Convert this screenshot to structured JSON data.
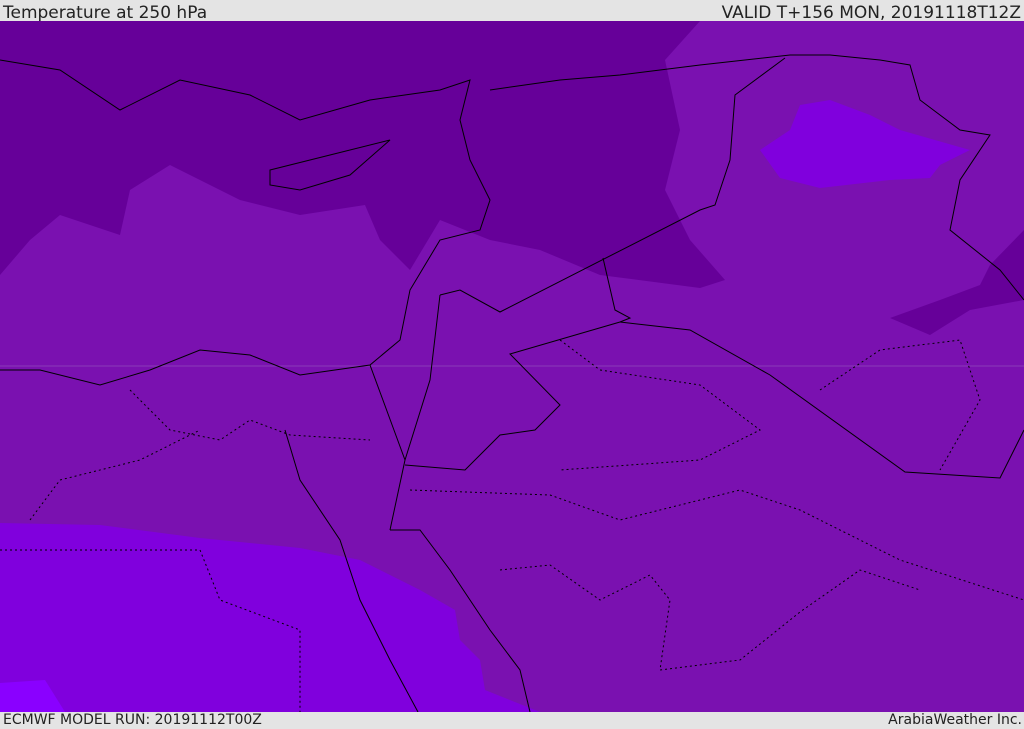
{
  "header": {
    "title": "Temperature at 250 hPa",
    "valid": "VALID T+156 MON, 20191118T12Z"
  },
  "footer": {
    "model_run": "ECMWF MODEL RUN: 20191112T00Z",
    "credit": "ArabiaWeather Inc."
  },
  "colors": {
    "darkest": "#660099",
    "mid": "#7a11b0",
    "light": "#8000dd",
    "lightest": "#8a00ff",
    "borders": "#000000"
  }
}
